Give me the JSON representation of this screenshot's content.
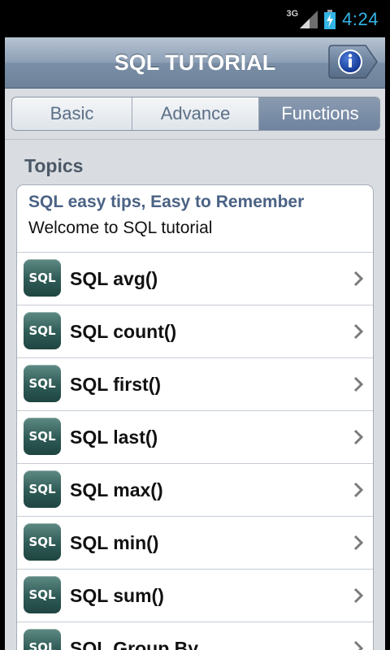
{
  "status_bar": {
    "network": "3G",
    "time": "4:24"
  },
  "title_bar": {
    "title": "SQL TUTORIAL",
    "info_icon": "info-icon"
  },
  "tabs": [
    {
      "label": "Basic",
      "active": false
    },
    {
      "label": "Advance",
      "active": false
    },
    {
      "label": "Functions",
      "active": true
    }
  ],
  "section": {
    "title": "Topics"
  },
  "header_card": {
    "title": "SQL easy tips, Easy to Remember",
    "subtitle": "Welcome to SQL tutorial"
  },
  "items": [
    {
      "icon_text": "SQL",
      "label": "SQL avg()"
    },
    {
      "icon_text": "SQL",
      "label": "SQL count()"
    },
    {
      "icon_text": "SQL",
      "label": "SQL first()"
    },
    {
      "icon_text": "SQL",
      "label": "SQL last()"
    },
    {
      "icon_text": "SQL",
      "label": "SQL max()"
    },
    {
      "icon_text": "SQL",
      "label": "SQL min()"
    },
    {
      "icon_text": "SQL",
      "label": "SQL sum()"
    },
    {
      "icon_text": "SQL",
      "label": "SQL Group By"
    }
  ],
  "colors": {
    "title_bar": "#8d9fb5",
    "active_tab": "#6f83a0",
    "clock": "#33b5e5",
    "icon_bg": "#2e5a55"
  }
}
